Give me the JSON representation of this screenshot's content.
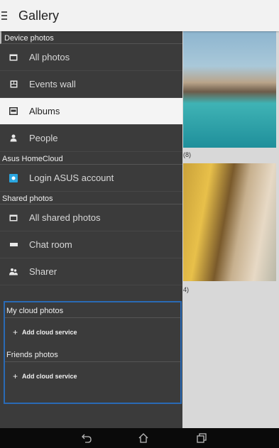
{
  "app": {
    "title": "Gallery"
  },
  "gallery": {
    "captions": [
      "(8)",
      "4)"
    ]
  },
  "drawer": {
    "device_header": "Device photos",
    "device_items": [
      {
        "label": "All photos",
        "icon": "photos-icon"
      },
      {
        "label": "Events wall",
        "icon": "events-icon"
      },
      {
        "label": "Albums",
        "icon": "albums-icon",
        "active": true
      },
      {
        "label": "People",
        "icon": "person-icon"
      }
    ],
    "homecloud_header": "Asus HomeCloud",
    "login_label": "Login ASUS account",
    "shared_header": "Shared photos",
    "shared_items": [
      {
        "label": "All shared photos",
        "icon": "photos-icon"
      },
      {
        "label": "Chat room",
        "icon": "chat-icon"
      },
      {
        "label": "Sharer",
        "icon": "people-icon"
      }
    ],
    "mycloud_header": "My cloud photos",
    "add_cloud_label": "Add cloud service",
    "friends_header": "Friends photos",
    "add_cloud_label_2": "Add cloud service"
  },
  "colors": {
    "drawer_bg": "#3b3b3b",
    "active_item_bg": "#f4f4f4",
    "highlight_border": "#2a6ab5",
    "login_icon": "#2aa6e0"
  },
  "navbar": {
    "buttons": [
      "back-icon",
      "home-icon",
      "recent-apps-icon"
    ]
  }
}
